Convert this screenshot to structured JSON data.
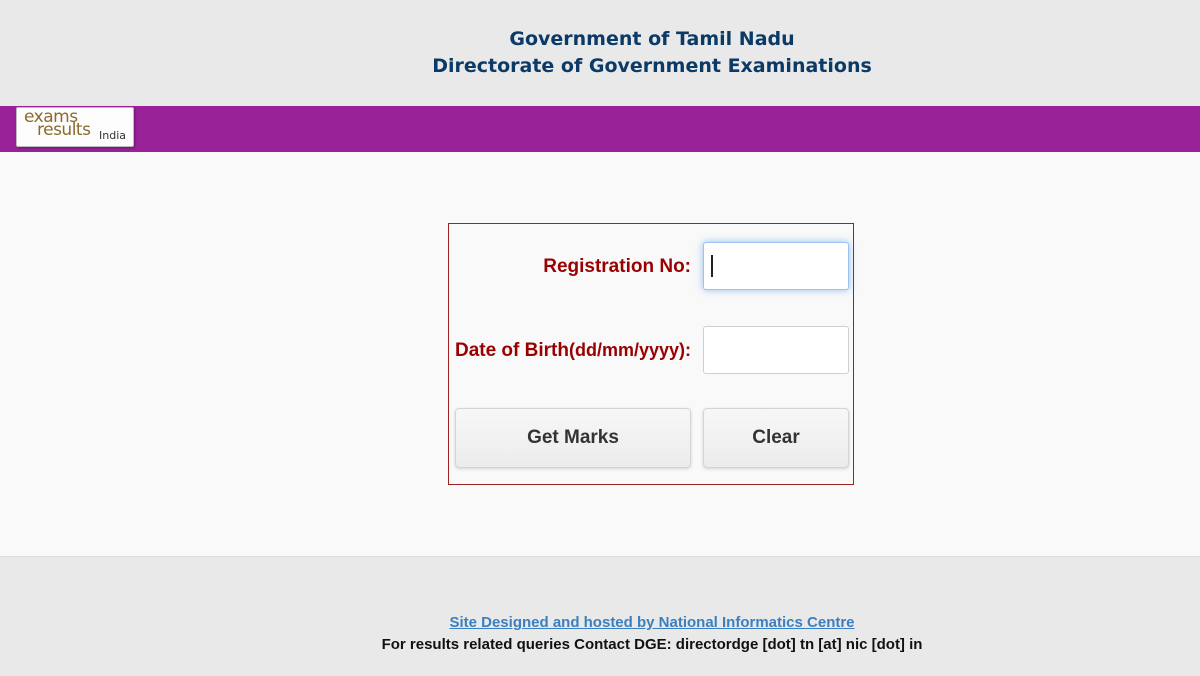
{
  "header": {
    "line1": "Government of Tamil Nadu",
    "line2": "Directorate of Government Examinations"
  },
  "logo": {
    "word1": "exams",
    "word2": "results",
    "word3": "India"
  },
  "form": {
    "registration_label": "Registration No:",
    "registration_value": "",
    "dob_label": "Date of Birth",
    "dob_format": "(dd/mm/yyyy):",
    "dob_value": "",
    "get_marks_label": "Get Marks",
    "clear_label": "Clear"
  },
  "footer": {
    "link_text": "Site Designed and hosted by National Informatics Centre",
    "contact_text": "For results related queries Contact DGE:  directordge [dot] tn [at] nic [dot] in"
  },
  "colors": {
    "band": "#992299",
    "title": "#0b3a66",
    "label": "#990000",
    "link": "#3b7fc0"
  }
}
